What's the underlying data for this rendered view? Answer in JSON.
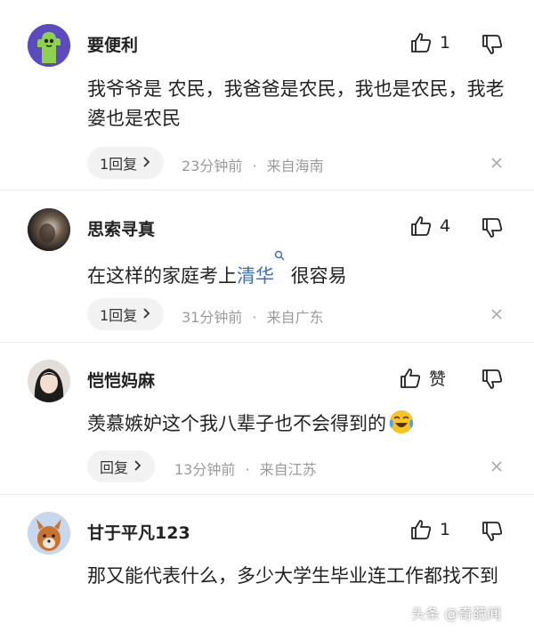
{
  "comments": [
    {
      "username": "要便利",
      "like_count": "1",
      "text": "我爷爷是 农民，我爸爸是农民，我也是农民，我老婆也是农民",
      "reply_label": "1回复",
      "time": "23分钟前",
      "location": "来自海南"
    },
    {
      "username": "思索寻真",
      "like_count": "4",
      "text_before": "在这样的家庭考上",
      "link_text": "清华",
      "text_after": " 很容易",
      "reply_label": "1回复",
      "time": "31分钟前",
      "location": "来自广东"
    },
    {
      "username": "恺恺妈麻",
      "like_count": "赞",
      "text": "羡慕嫉妒这个我八辈子也不会得到的",
      "reply_label": "回复",
      "time": "13分钟前",
      "location": "来自江苏"
    },
    {
      "username": "甘于平凡123",
      "like_count": "1",
      "text": "那又能代表什么，多少大学生毕业连工作都找不到"
    }
  ],
  "separator": "·",
  "watermark": "头条 @奇葩闻"
}
